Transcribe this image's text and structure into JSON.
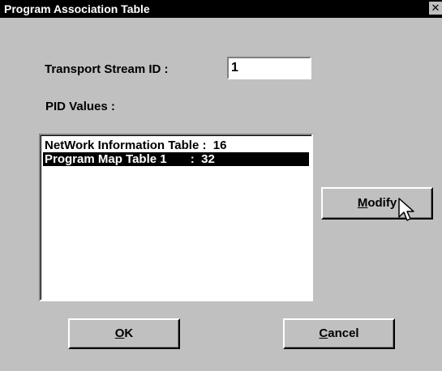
{
  "window": {
    "title": "Program Association Table",
    "close_glyph": "✕"
  },
  "form": {
    "tsid_label": "Transport Stream ID :",
    "tsid_value": "1",
    "pid_label": "PID Values :"
  },
  "pid_list": [
    {
      "text": "NetWork Information Table :  16",
      "selected": false
    },
    {
      "text": "Program Map Table 1       :  32",
      "selected": true
    }
  ],
  "buttons": {
    "modify": {
      "accel": "M",
      "rest": "odify"
    },
    "ok": {
      "accel": "O",
      "rest": "K"
    },
    "cancel": {
      "accel": "C",
      "rest": "ancel"
    }
  },
  "icons": {
    "cursor": "arrow-cursor-icon"
  }
}
